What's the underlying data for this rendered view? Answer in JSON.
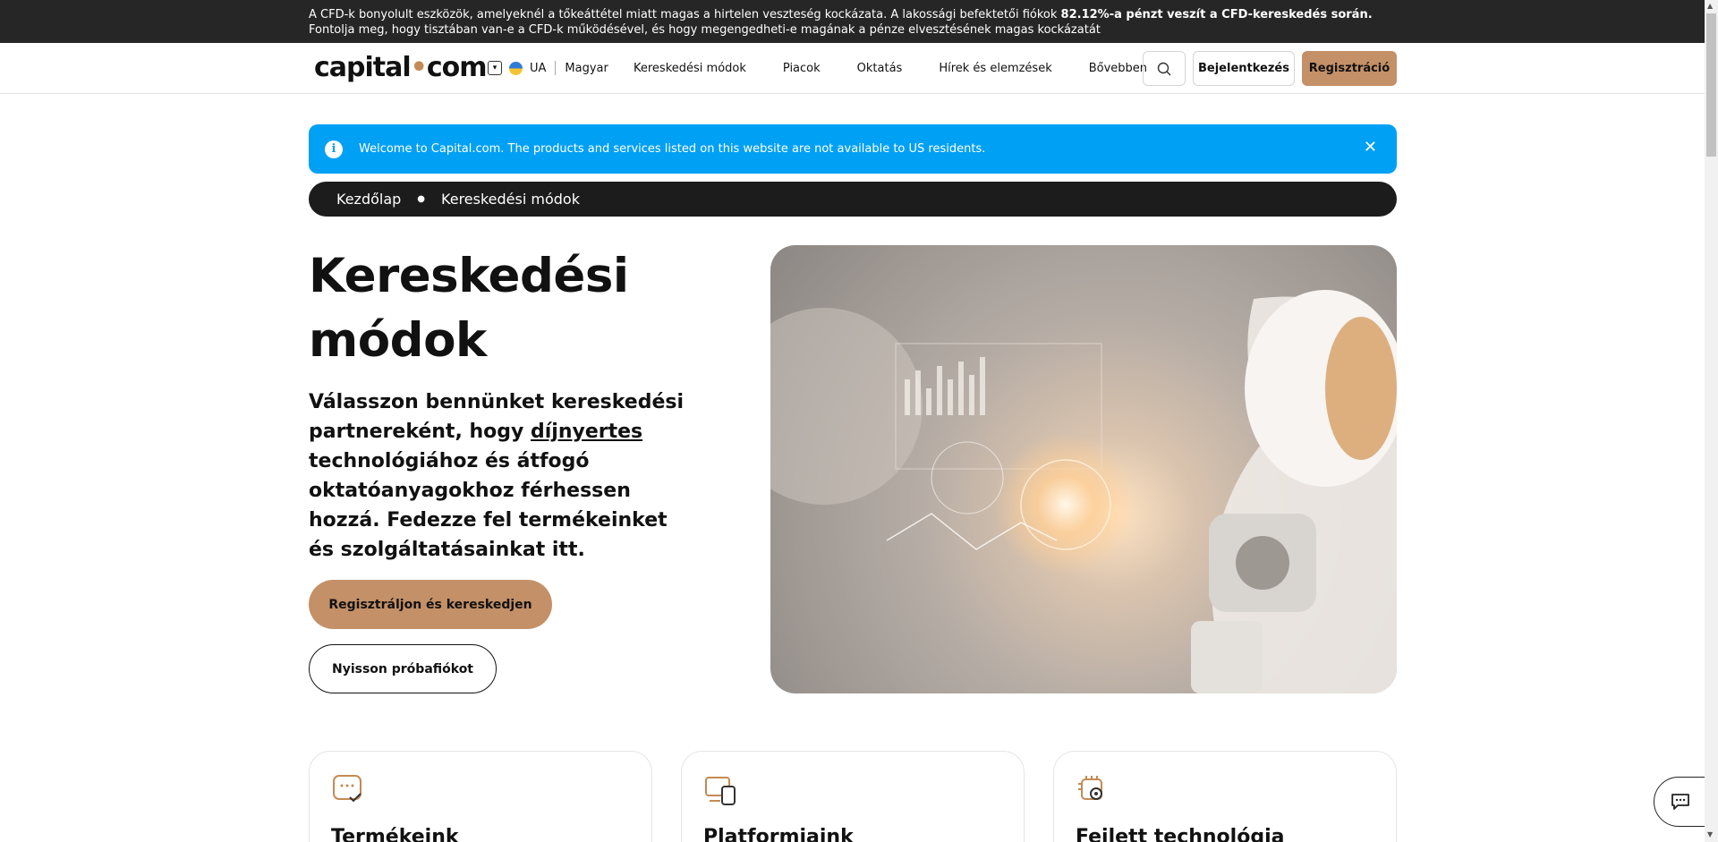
{
  "risk_warning": {
    "text_before": "A CFD-k bonyolult eszközök, amelyeknél a tőkeáttétel miatt magas a hirtelen veszteség kockázata. A lakossági befektetői fiókok ",
    "text_bold": "82.12%-a pénzt veszít a CFD-kereskedés során.",
    "text_after": " Fontolja meg, hogy tisztában van-e a CFD-k működésével, és hogy megengedheti-e magának a pénze elvesztésének magas kockázatát"
  },
  "header": {
    "logo_part1": "capital",
    "logo_dot": "•",
    "logo_part2": "com",
    "region": "UA",
    "language": "Magyar",
    "nav": [
      "Kereskedési módok",
      "Piacok",
      "Oktatás",
      "Hírek és elemzések",
      "Bővebben"
    ],
    "login_label": "Bejelentkezés",
    "register_label": "Regisztráció"
  },
  "notice": {
    "text": "Welcome to Capital.com. The products and services listed on this website are not available to US residents.",
    "close": "✕"
  },
  "breadcrumb": {
    "home": "Kezdőlap",
    "current": "Kereskedési módok"
  },
  "hero": {
    "title_line1": "Kereskedési",
    "title_line2": "módok",
    "subtitle_part1": "Válasszon bennünket kereskedési partnereként, hogy ",
    "subtitle_link": "díjnyertes",
    "subtitle_part2": " technológiához és átfogó oktatóanyagokhoz férhessen hozzá. Fedezze fel termékeinket és szolgáltatásainkat itt.",
    "cta_primary": "Regisztráljon és kereskedjen",
    "cta_secondary": "Nyisson próbafiókot"
  },
  "cards": [
    {
      "title": "Termékeink",
      "icon": "chat-check-icon"
    },
    {
      "title": "Platformjaink",
      "icon": "devices-icon"
    },
    {
      "title": "Fejlett technológia",
      "icon": "chip-gear-icon"
    }
  ],
  "colors": {
    "accent": "#c49067",
    "notice_blue": "#00a0f5",
    "dark": "#1c1c1c"
  }
}
